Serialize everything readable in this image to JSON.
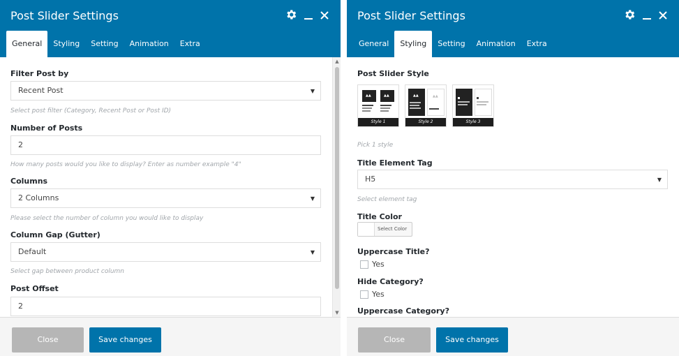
{
  "left_panel": {
    "title": "Post Slider Settings",
    "tabs": [
      {
        "label": "General",
        "active": true
      },
      {
        "label": "Styling"
      },
      {
        "label": "Setting"
      },
      {
        "label": "Animation"
      },
      {
        "label": "Extra"
      }
    ],
    "icons": {
      "settings": "gear-icon",
      "minimize": "minimize-icon",
      "close": "close-icon"
    },
    "fields": {
      "filter": {
        "label": "Filter Post by",
        "value": "Recent Post",
        "help": "Select post filter (Category, Recent Post or Post ID)"
      },
      "number": {
        "label": "Number of Posts",
        "value": "2",
        "help": "How many posts would you like to display? Enter as number example \"4\""
      },
      "columns": {
        "label": "Columns",
        "value": "2 Columns",
        "help": "Please select the number of column you would like to display"
      },
      "gap": {
        "label": "Column Gap (Gutter)",
        "value": "Default",
        "help": "Select gap between product column"
      },
      "offset": {
        "label": "Post Offset",
        "value": "2"
      }
    },
    "footer": {
      "close_label": "Close",
      "save_label": "Save changes"
    }
  },
  "right_panel": {
    "title": "Post Slider Settings",
    "tabs": [
      {
        "label": "General"
      },
      {
        "label": "Styling",
        "active": true
      },
      {
        "label": "Setting"
      },
      {
        "label": "Animation"
      },
      {
        "label": "Extra"
      }
    ],
    "icons": {
      "settings": "gear-icon",
      "minimize": "minimize-icon",
      "close": "close-icon"
    },
    "fields": {
      "style": {
        "label": "Post Slider Style",
        "options": [
          "Style 1",
          "Style 2",
          "Style 3"
        ],
        "help": "Pick 1 style"
      },
      "tag": {
        "label": "Title Element Tag",
        "value": "H5",
        "help": "Select element tag"
      },
      "color": {
        "label": "Title Color",
        "button": "Select Color"
      },
      "uppercase_title": {
        "label": "Uppercase Title?",
        "option": "Yes"
      },
      "hide_category": {
        "label": "Hide Category?",
        "option": "Yes"
      },
      "uppercase_category": {
        "label": "Uppercase Category?"
      }
    },
    "footer": {
      "close_label": "Close",
      "save_label": "Save changes"
    }
  },
  "colors": {
    "header": "#0073aa",
    "save_button": "#0073aa",
    "close_button": "#b6b6b6",
    "help_text": "#a0a5aa"
  }
}
